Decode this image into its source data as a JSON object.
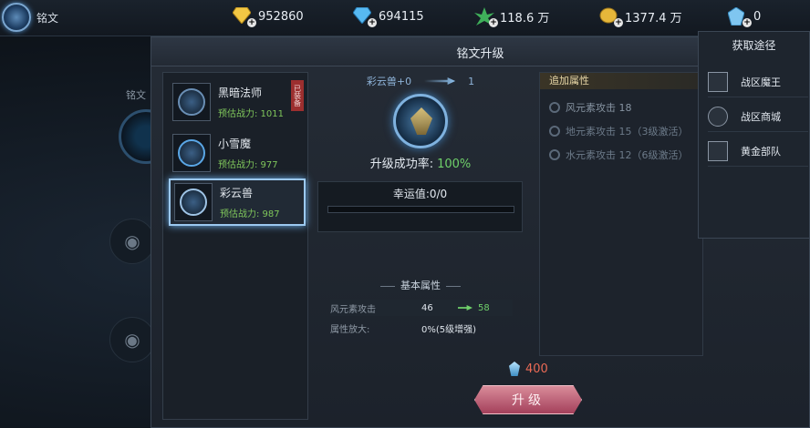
{
  "topbar": {
    "menu_label": "铭文",
    "resources": [
      {
        "icon": "gold-gem-icon",
        "value": "952860"
      },
      {
        "icon": "blue-diamond-icon",
        "value": "694115"
      },
      {
        "icon": "green-herb-icon",
        "value": "118.6 万"
      },
      {
        "icon": "gold-coin-icon",
        "value": "1377.4 万"
      },
      {
        "icon": "blue-crystal-icon",
        "value": "0"
      }
    ]
  },
  "background": {
    "side_label": "铭文"
  },
  "panel": {
    "title": "铭文升级",
    "list": [
      {
        "name": "黑暗法师",
        "power": "预估战力: 1011",
        "tag": "已装备"
      },
      {
        "name": "小雪魔",
        "power": "预估战力: 977"
      },
      {
        "name": "彩云兽",
        "power": "预估战力: 987"
      }
    ],
    "upgrade": {
      "from": "彩云兽+0",
      "to": "1",
      "rate_label": "升级成功率:",
      "rate_value": "100%",
      "luck_label": "幸运值:0/0",
      "luck_fraction": 0
    },
    "basic_title": "基本属性",
    "basic_attrs": [
      {
        "label": "风元素攻击",
        "current": "46",
        "next": "58"
      },
      {
        "label": "属性放大:",
        "current": "0%(5级增强)",
        "next": ""
      }
    ],
    "additional_title": "追加属性",
    "additional_attrs": [
      "风元素攻击 18",
      "地元素攻击 15（3级激活）",
      "水元素攻击 12（6级激活）"
    ],
    "cost": "400",
    "upgrade_button": "升级"
  },
  "obtain": {
    "title": "获取途径",
    "items": [
      "战区魔王",
      "战区商城",
      "黄金部队"
    ]
  },
  "colors": {
    "accent_green": "#6fd06a",
    "cost_red": "#ea6a55",
    "button_pink": "#a4405b"
  }
}
